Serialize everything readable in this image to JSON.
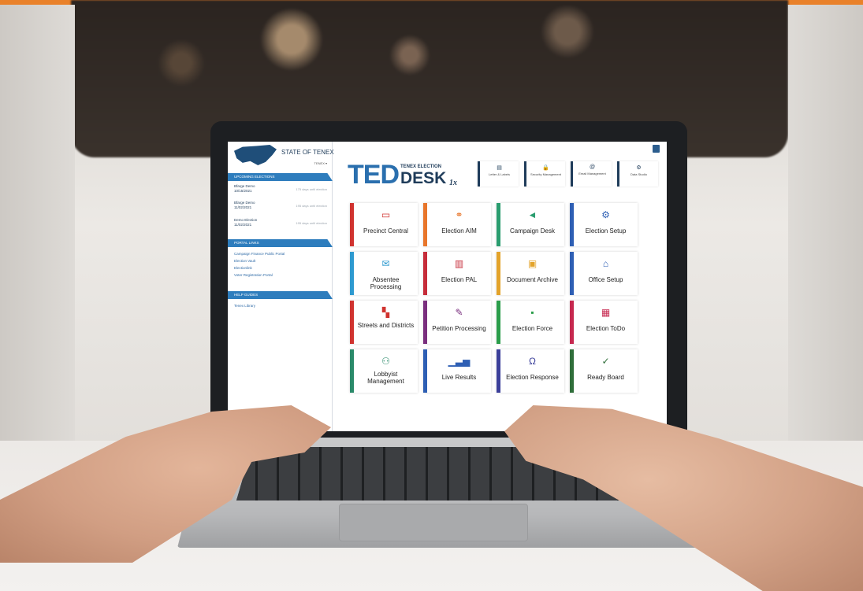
{
  "sidebar": {
    "state_title": "STATE OF TENEX",
    "state_dropdown": "TENEX ▾",
    "upcoming_header": "UPCOMING ELECTIONS",
    "elections": [
      {
        "name": "Bfarge Demo",
        "date": "10/15/2021",
        "note": "175 days until election"
      },
      {
        "name": "Bfarge Demo",
        "date": "11/02/2021",
        "note": "195 days until election"
      },
      {
        "name": "Demo Election",
        "date": "11/02/2021",
        "note": "195 days until election"
      }
    ],
    "portal_header": "PORTAL LINKS",
    "portal_links": [
      "Campaign Finance Public Portal",
      "Election Vault",
      "Electionlink",
      "Voter Registration Portal"
    ],
    "help_header": "HELP GUIDES",
    "help_links": [
      "Tenex Library"
    ]
  },
  "header": {
    "logo_ted": "TED",
    "logo_tenex": "TENEX ELECTION",
    "logo_desk": "DESK",
    "logo_version": "1x",
    "buttons": [
      {
        "icon": "document-icon",
        "glyph": "▤",
        "label": "Letter & Labels"
      },
      {
        "icon": "lock-icon",
        "glyph": "🔒",
        "label": "Security Management"
      },
      {
        "icon": "email-icon",
        "glyph": "@",
        "label": "Email Management"
      },
      {
        "icon": "gear-icon",
        "glyph": "⚙",
        "label": "Data Studio"
      }
    ]
  },
  "tiles": [
    {
      "label": "Precinct Central",
      "icon": "monitor-icon",
      "glyph": "▭",
      "color": "#d0332f"
    },
    {
      "label": "Election AIM",
      "icon": "users-icon",
      "glyph": "⚭",
      "color": "#e8762b"
    },
    {
      "label": "Campaign Desk",
      "icon": "megaphone-icon",
      "glyph": "◄",
      "color": "#2a9d6f"
    },
    {
      "label": "Election Setup",
      "icon": "gear-icon",
      "glyph": "⚙",
      "color": "#2e5fb4"
    },
    {
      "label": "Absentee Processing",
      "icon": "envelope-icon",
      "glyph": "✉",
      "color": "#2e9ad0"
    },
    {
      "label": "Election PAL",
      "icon": "book-icon",
      "glyph": "▥",
      "color": "#c62d3a"
    },
    {
      "label": "Document Archive",
      "icon": "archive-icon",
      "glyph": "▣",
      "color": "#e3a32a"
    },
    {
      "label": "Office Setup",
      "icon": "bank-icon",
      "glyph": "⌂",
      "color": "#2e5fb4"
    },
    {
      "label": "Streets and Districts",
      "icon": "map-icon",
      "glyph": "▚",
      "color": "#d0332f"
    },
    {
      "label": "Petition Processing",
      "icon": "pen-icon",
      "glyph": "✎",
      "color": "#7a2f7e"
    },
    {
      "label": "Election Force",
      "icon": "briefcase-icon",
      "glyph": "▪",
      "color": "#2a9d4a"
    },
    {
      "label": "Election ToDo",
      "icon": "calendar-icon",
      "glyph": "▦",
      "color": "#c6284f"
    },
    {
      "label": "Lobbyist Management",
      "icon": "handshake-icon",
      "glyph": "⚇",
      "color": "#2a8a6a"
    },
    {
      "label": "Live Results",
      "icon": "chart-icon",
      "glyph": "▁▃▅",
      "color": "#2e5fb4"
    },
    {
      "label": "Election Response",
      "icon": "headset-icon",
      "glyph": "Ω",
      "color": "#3b3f9a"
    },
    {
      "label": "Ready Board",
      "icon": "check-icon",
      "glyph": "✓",
      "color": "#2f6e3a"
    }
  ]
}
